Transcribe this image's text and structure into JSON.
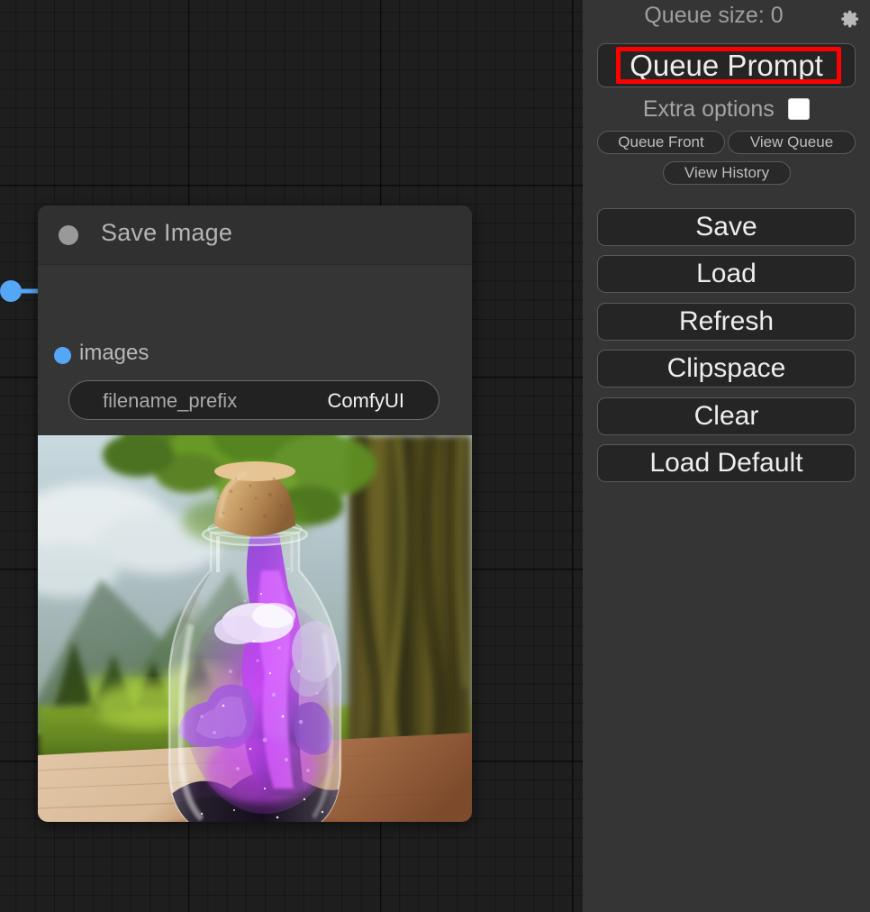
{
  "canvas": {
    "node": {
      "title": "Save Image",
      "collapse_dot_color": "#999999",
      "input_slot": {
        "label": "images",
        "dot_color": "#54a7f5"
      },
      "widgets": [
        {
          "label": "filename_prefix",
          "value": "ComfyUI"
        }
      ],
      "preview_image": {
        "alt": "Glass bottle with cork stopper containing a purple nebula galaxy, resting on a wooden table with a green mountain landscape behind"
      }
    }
  },
  "sidebar": {
    "queue_size_label": "Queue size: 0",
    "gear_icon": "gear-icon",
    "queue_prompt_label": "Queue Prompt",
    "queue_prompt_highlight_color": "#ff0000",
    "extra_options_label": "Extra options",
    "extra_options_checked": false,
    "small_buttons": [
      {
        "label": "Queue Front"
      },
      {
        "label": "View Queue"
      },
      {
        "label": "View History"
      }
    ],
    "main_buttons": [
      {
        "label": "Save"
      },
      {
        "label": "Load"
      },
      {
        "label": "Refresh"
      },
      {
        "label": "Clipspace"
      },
      {
        "label": "Clear"
      },
      {
        "label": "Load Default"
      }
    ]
  },
  "theme": {
    "canvas_bg": "#1e1e1e",
    "panel_bg": "#353535",
    "node_title_bg": "#303030",
    "button_bg": "#252525",
    "button_border": "#595959",
    "text_primary": "#ededed",
    "text_secondary": "#a5a5a5",
    "link_color": "#54a7f5"
  }
}
